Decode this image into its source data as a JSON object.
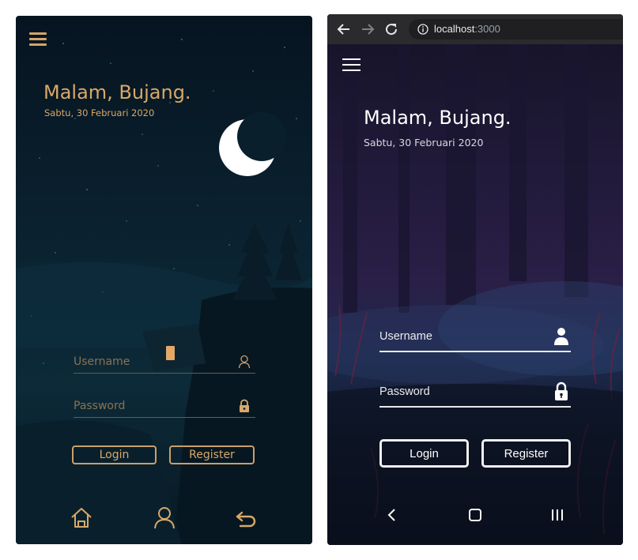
{
  "left_app": {
    "greeting": "Malam, Bujang.",
    "date": "Sabtu, 30 Februari 2020",
    "username_placeholder": "Username",
    "password_placeholder": "Password",
    "login_label": "Login",
    "register_label": "Register",
    "bottom_nav": [
      "home-icon",
      "profile-icon",
      "logout-icon"
    ],
    "accent_color": "#d8a868",
    "background_color": "#0b2331"
  },
  "right_app": {
    "browser": {
      "url_host": "localhost",
      "url_port": ":3000"
    },
    "greeting": "Malam, Bujang.",
    "date": "Sabtu, 30 Februari 2020",
    "username_placeholder": "Username",
    "password_placeholder": "Password",
    "login_label": "Login",
    "register_label": "Register",
    "system_nav": [
      "back-icon",
      "home-icon",
      "recents-icon"
    ],
    "accent_color": "#ffffff"
  }
}
